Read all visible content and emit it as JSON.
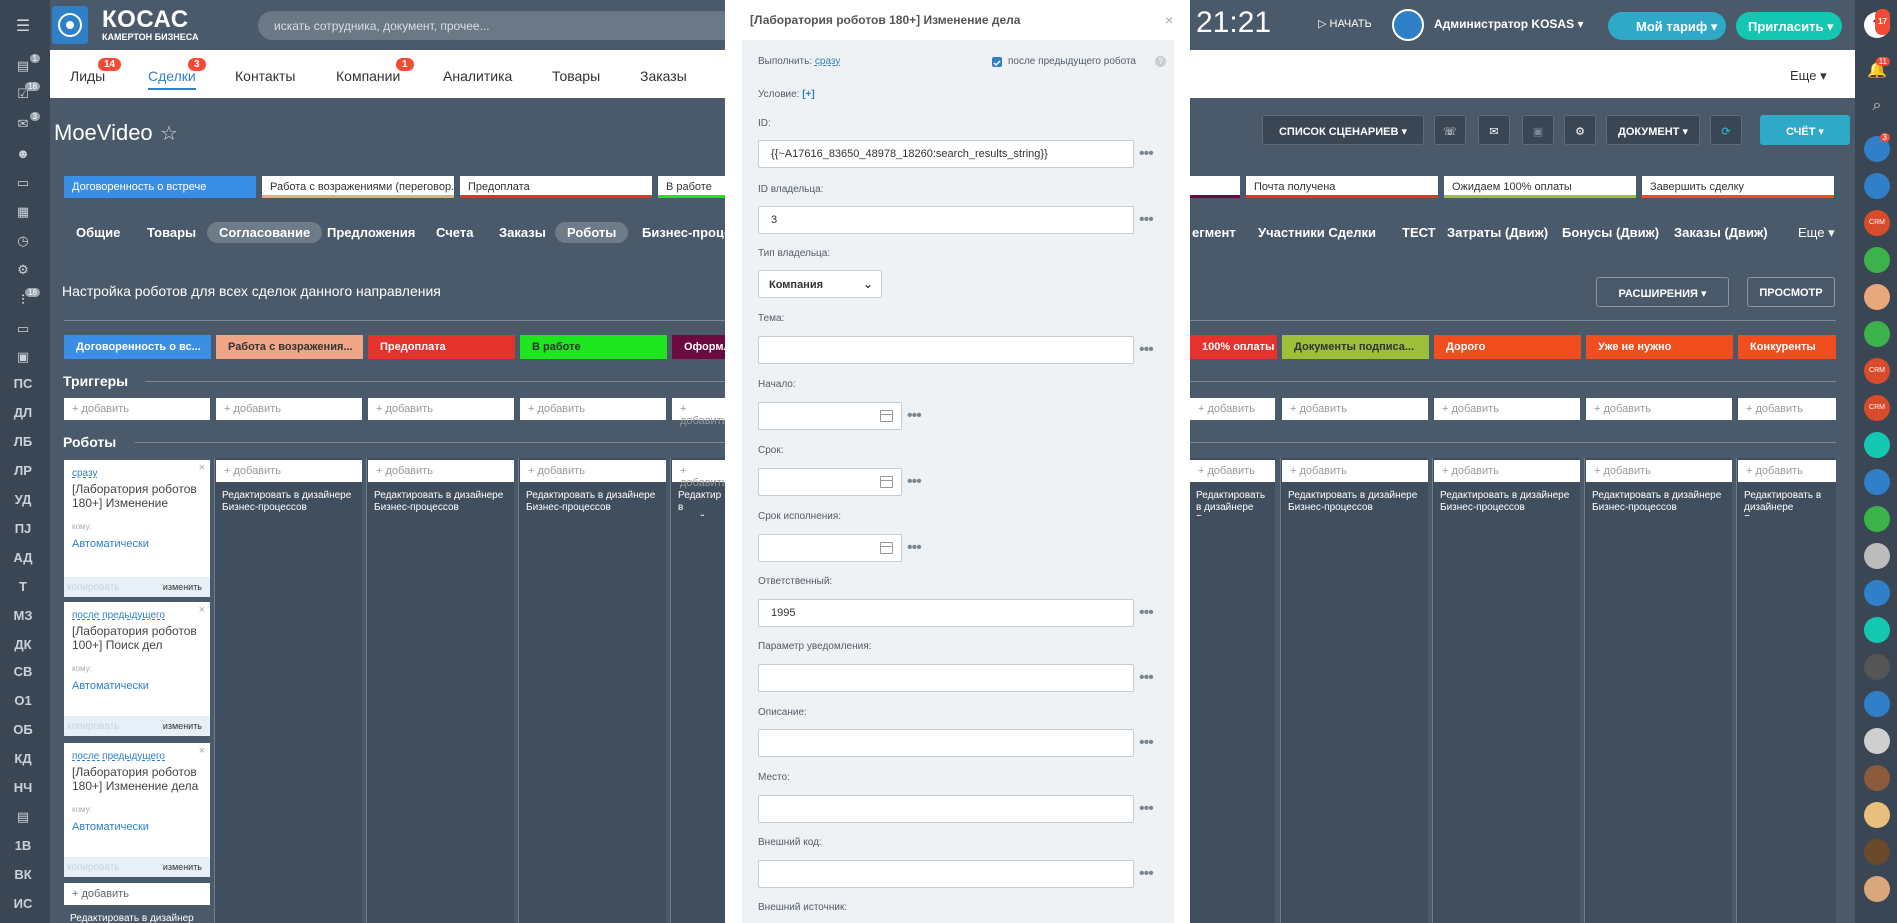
{
  "header": {
    "logo_title": "КОСАС",
    "logo_subtitle": "КАМЕРТОН БИЗНЕСА",
    "search_placeholder": "искать сотрудника, документ, прочее...",
    "clock": "21:21",
    "start_label": "НАЧАТЬ",
    "user_name": "Администратор KOSAS",
    "tariff_label": "Мой тариф",
    "invite_label": "Пригласить"
  },
  "menu": {
    "items": [
      {
        "label": "Лиды",
        "badge": "14"
      },
      {
        "label": "Сделки",
        "badge": "3"
      },
      {
        "label": "Контакты",
        "badge": ""
      },
      {
        "label": "Компании",
        "badge": "1"
      },
      {
        "label": "Аналитика",
        "badge": ""
      },
      {
        "label": "Товары",
        "badge": ""
      },
      {
        "label": "Заказы",
        "badge": ""
      }
    ],
    "more_label": "Еще"
  },
  "left_sidebar": {
    "icon_badges": [
      "1",
      "18",
      "3",
      "18"
    ],
    "letters": [
      "ПС",
      "ДЛ",
      "ЛБ",
      "ЛР",
      "УД",
      "ПJ",
      "АД",
      "Т",
      "МЗ",
      "ДК",
      "СВ",
      "О1",
      "ОБ",
      "КД",
      "НЧ",
      "1В",
      "ВК",
      "ИС"
    ]
  },
  "right_sidebar": {
    "badges": {
      "help": "17",
      "notifications": "11",
      "chat1": "3"
    },
    "crm_label": "CRM"
  },
  "deal": {
    "title": "MoeVideo",
    "buttons": {
      "scenarios": "СПИСОК СЦЕНАРИЕВ",
      "document": "ДОКУМЕНТ",
      "invoice": "СЧЁТ"
    },
    "stages_top": [
      {
        "label": "Договоренность о встрече",
        "color": "#3a8ee6",
        "text_color": "#ffffff"
      },
      {
        "label": "Работа с возражениями (переговор...",
        "color": "#ffffff",
        "text_color": "#333333"
      },
      {
        "label": "Предоплата",
        "color": "#ffffff",
        "text_color": "#333333"
      },
      {
        "label": "В работе",
        "color": "#ffffff",
        "text_color": "#333333"
      },
      {
        "label": "Почта получена",
        "color": "#ffffff",
        "text_color": "#333333"
      },
      {
        "label": "Ожидаем 100% оплаты",
        "color": "#ffffff",
        "text_color": "#333333"
      },
      {
        "label": "Завершить сделку",
        "color": "#ffffff",
        "text_color": "#333333"
      }
    ],
    "tabs": [
      "Общие",
      "Товары",
      "Согласование",
      "Предложения",
      "Счета",
      "Заказы",
      "Роботы",
      "Бизнес-процессы",
      "егмент",
      "Участники Сделки",
      "ТЕСТ",
      "Затраты (Движ)",
      "Бонусы (Движ)",
      "Заказы (Движ)",
      "Еще"
    ]
  },
  "robots": {
    "heading": "Настройка роботов для всех сделок данного направления",
    "extensions_button": "РАСШИРЕНИЯ",
    "preview_button": "ПРОСМОТР",
    "stages": [
      {
        "label": "Договоренность о вс...",
        "color": "#3a8ee6",
        "text_color": "#ffffff"
      },
      {
        "label": "Работа с возражения...",
        "color": "#f0a488",
        "text_color": "#333333"
      },
      {
        "label": "Предоплата",
        "color": "#e5322d",
        "text_color": "#ffffff"
      },
      {
        "label": "В работе",
        "color": "#1ee51e",
        "text_color": "#333333"
      },
      {
        "label": "Оформл",
        "color": "#6a0a3e",
        "text_color": "#ffffff"
      },
      {
        "label": "100% оплаты",
        "color": "#e5322d",
        "text_color": "#ffffff"
      },
      {
        "label": "Документы подписа...",
        "color": "#9dbf3a",
        "text_color": "#333333"
      },
      {
        "label": "Дорого",
        "color": "#f04e1e",
        "text_color": "#ffffff"
      },
      {
        "label": "Уже не нужно",
        "color": "#f04e1e",
        "text_color": "#ffffff"
      },
      {
        "label": "Конкуренты",
        "color": "#f04e1e",
        "text_color": "#ffffff"
      }
    ],
    "triggers_label": "Триггеры",
    "robots_label": "Роботы",
    "add_label": "+ добавить",
    "column_text": "Редактировать в дизайнере Бизнес-процессов",
    "robot_cards": [
      {
        "link": "сразу",
        "title": "[Лаборатория роботов 180+] Изменение",
        "who": "кому:",
        "auto": "Автоматически",
        "copy": "копировать",
        "edit": "изменить"
      },
      {
        "link": "после предыдущего",
        "title": "[Лаборатория роботов 100+] Поиск дел",
        "who": "кому:",
        "auto": "Автоматически",
        "copy": "копировать",
        "edit": "изменить"
      },
      {
        "link": "после предыдущего",
        "title": "[Лаборатория роботов 180+] Изменение дела",
        "who": "кому:",
        "auto": "Автоматически",
        "copy": "копировать",
        "edit": "изменить"
      }
    ],
    "bottom_add": "+ добавить",
    "bottom_text": "Редактировать в дизайнер"
  },
  "modal": {
    "title": "[Лаборатория роботов 180+] Изменение дела",
    "execute_label": "Выполнить:",
    "execute_value": "сразу",
    "after_prev_label": "после предыдущего робота",
    "condition_label": "Условие:",
    "condition_value": "[+]",
    "fields": {
      "id": {
        "label": "ID:",
        "value": "{{~A17616_83650_48978_18260:search_results_string}}"
      },
      "owner_id": {
        "label": "ID владельца:",
        "value": "3"
      },
      "owner_type": {
        "label": "Тип владельца:",
        "value": "Компания"
      },
      "subject": {
        "label": "Тема:",
        "value": ""
      },
      "start": {
        "label": "Начало:",
        "value": ""
      },
      "deadline": {
        "label": "Срок:",
        "value": ""
      },
      "exec_deadline": {
        "label": "Срок исполнения:",
        "value": ""
      },
      "responsible": {
        "label": "Ответственный:",
        "value": "1995"
      },
      "notify": {
        "label": "Параметр уведомления:",
        "value": ""
      },
      "description": {
        "label": "Описание:",
        "value": ""
      },
      "place": {
        "label": "Место:",
        "value": ""
      },
      "external_code": {
        "label": "Внешний код:",
        "value": ""
      },
      "external_source": {
        "label": "Внешний источник:",
        "value": ""
      }
    }
  },
  "colors": {
    "accent": "#2f7fc9",
    "badge": "#f54a35",
    "background": "#4b5a6a"
  }
}
